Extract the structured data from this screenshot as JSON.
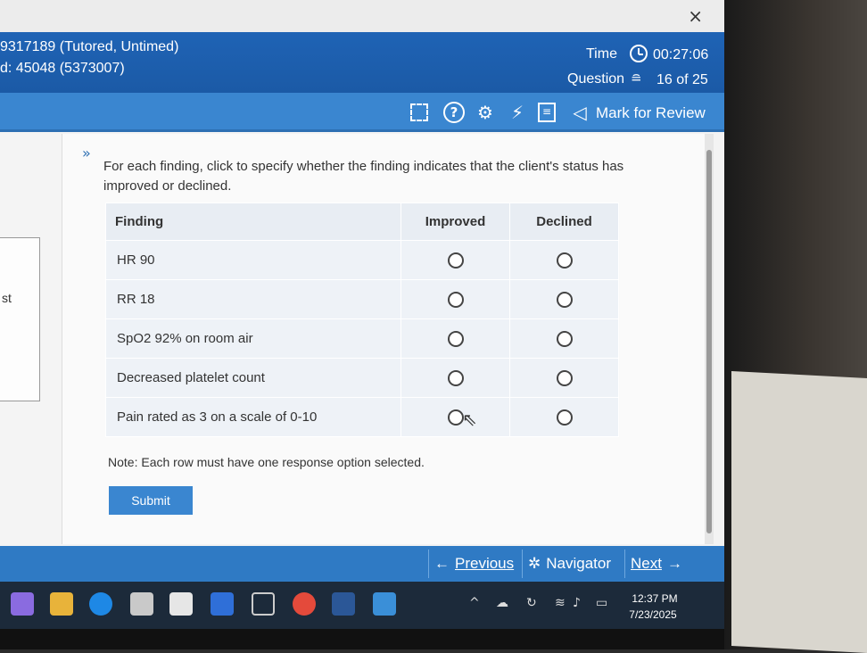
{
  "window": {
    "close_symbol": "×"
  },
  "header": {
    "test_id": "9317189  (Tutored, Untimed)",
    "item_id": "d: 45048 (5373007)",
    "time_label": "Time",
    "time_value": "00:27:06",
    "question_label": "Question",
    "question_value": "16 of 25"
  },
  "toolbar": {
    "mark_for_review": "Mark for Review",
    "icons": [
      "fullscreen-icon",
      "help-icon",
      "settings-icon",
      "calculator-icon",
      "notes-icon",
      "flag-icon"
    ]
  },
  "left_panel": {
    "text": "st"
  },
  "question": {
    "instruction": "For each finding, click to specify whether the finding indicates that the client's status has improved or declined.",
    "columns": [
      "Finding",
      "Improved",
      "Declined"
    ],
    "rows": [
      {
        "finding": "HR 90"
      },
      {
        "finding": "RR 18"
      },
      {
        "finding": "SpO2 92% on room air"
      },
      {
        "finding": "Decreased platelet count"
      },
      {
        "finding": "Pain rated as 3 on a scale of 0-10"
      }
    ],
    "note": "Note:  Each row must have one response option selected.",
    "submit_label": "Submit"
  },
  "footer": {
    "previous_label": "Previous",
    "navigator_label": "Navigator",
    "next_label": "Next"
  },
  "taskbar": {
    "time": "12:37 PM",
    "date": "7/23/2025"
  },
  "colors": {
    "header_blue": "#1f63b5",
    "toolbar_blue": "#3a86d0",
    "footer_blue": "#2f7ac4"
  }
}
